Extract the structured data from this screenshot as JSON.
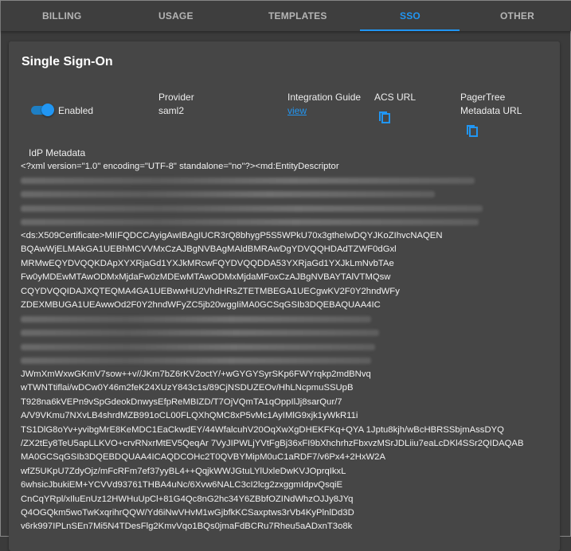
{
  "tabs": [
    {
      "label": "BILLING"
    },
    {
      "label": "USAGE"
    },
    {
      "label": "TEMPLATES"
    },
    {
      "label": "SSO",
      "active": true
    },
    {
      "label": "OTHER"
    }
  ],
  "colors": {
    "accent": "#2196f3"
  },
  "card": {
    "title": "Single Sign-On",
    "enabled_label": "Enabled",
    "enabled": true,
    "provider_label": "Provider",
    "provider_value": "saml2",
    "guide_label": "Integration Guide",
    "guide_link": "view",
    "acs_label": "ACS URL",
    "pt_label_1": "PagerTree",
    "pt_label_2": "Metadata URL",
    "idp_label": "IdP Metadata",
    "xml_line": "<?xml version=\"1.0\" encoding=\"UTF-8\" standalone=\"no\"?><md:EntityDescriptor",
    "cert_lines_a": [
      "<ds:X509Certificate>MIIFQDCCAyigAwIBAgIUCR3rQ8bhygP5S5WPkU70x3gtheIwDQYJKoZIhvcNAQEN",
      "BQAwWjELMAkGA1UEBhMCVVMxCzAJBgNVBAgMAldBMRAwDgYDVQQHDAdTZWF0dGxl",
      "MRMwEQYDVQQKDApXYXRjaGd1YXJkMRcwFQYDVQQDDA53YXRjaGd1YXJkLmNvbTAe",
      "Fw0yMDEwMTAwODMxMjdaFw0zMDEwMTAwODMxMjdaMFoxCzAJBgNVBAYTAlVTMQsw",
      "CQYDVQQIDAJXQTEQMA4GA1UEBwwHU2VhdHRsZTETMBEGA1UECgwKV2F0Y2hndWFy",
      "ZDEXMBUGA1UEAwwOd2F0Y2hndWFyZC5jb20wggIiMA0GCSqGSIb3DQEBAQUAA4IC"
    ],
    "cert_lines_b": [
      "JWmXmWxwGKmV7sow++v//JKm7bZ6rKV2octY/+wGYGYSyrSKp6FWYrqkp2mdBNvq",
      "wTWNTtiflai/wDCw0Y46m2feK24XUzY843c1s/89CjNSDUZEOv/HhLNcpmuSSUpB",
      "T928na6kVEPn9vSpGdeokDnwysEfpReMBIZD/T7OjVQmTA1qOppIlJj8sarQur/7",
      "A/V9VKmu7NXvLB4shrdMZB991oCL00FLQXhQMC8xP5vMc1AyIMlG9xjk1yWkR11i",
      "TS1DlG8oYv+yvibgMrE8KeMDC1EaCkwdEY/44WfalcuhV20OqXwXgDHEKFKq+QYA 1Jptu8kjh/wBcHBRSSbjmAssDYQ",
      "/ZX2tEy8TeU5apLLKVO+crvRNxrMtEV5QeqAr 7VyJIPWLjYVtFgBj36xFI9bXhchrhzFbxvzMSrJDLiiu7eaLcDKl4SSr2QIDAQAB",
      "MA0GCSqGSIb3DQEBDQUAA4ICAQDCOHc2T0QVBYMipM0uC1aRDF7/v6Px4+2HxW2A",
      "wfZ5UKpU7ZdyOjz/mFcRFm7ef37yyBL4++QqjkWWJGtuLYlUxleDwKVJOprqIkxL",
      "6whsicJbukiEM+YCVVd93761THBA4uNc/6Xvw6NALC3cI2lcg2zxggmIdpvQsqiE",
      "CnCqYRpl/xIluEnUz12HWHuUpCl+81G4Qc8nG2hc34Y6ZBbfOZINdWhzOJJy8JYq",
      "Q4OGQkm5woTwKxqrihrQQW/Yd6iNwVHvM1wGjbfkKCSaxptws3rVb4KyPlnlDd3D",
      "v6rk997IPLnSEn7Mi5N4TDesFlg2KmvVqo1BQs0jmaFdBCRu7Rheu5aADxnT3o8k"
    ]
  }
}
